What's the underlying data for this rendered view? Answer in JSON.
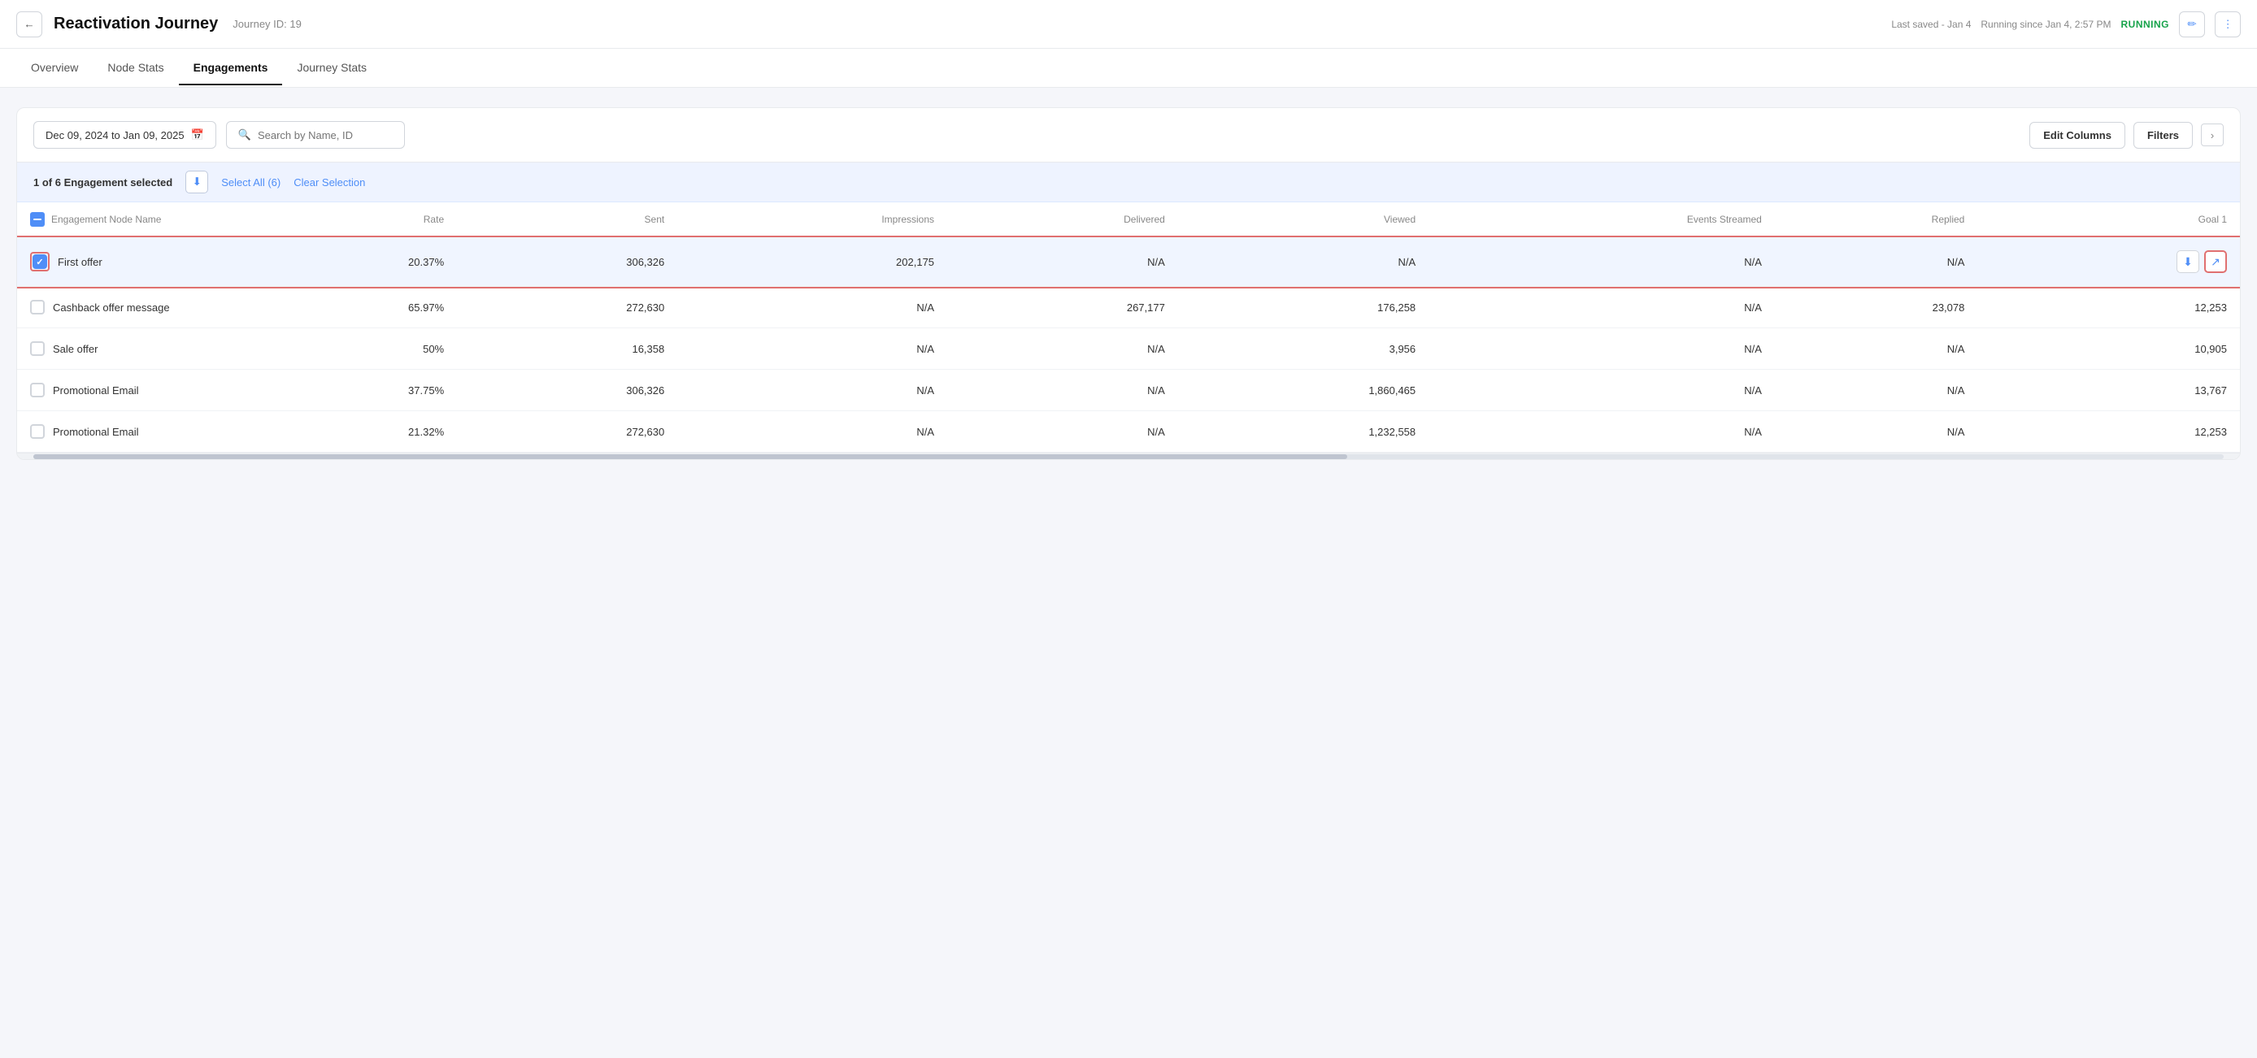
{
  "header": {
    "back_label": "←",
    "title": "Reactivation Journey",
    "journey_id_label": "Journey ID: 19",
    "meta_saved": "Last saved - Jan 4",
    "meta_running": "Running since Jan 4, 2:57 PM",
    "running_status": "RUNNING",
    "edit_icon": "✏",
    "more_icon": "⋮"
  },
  "tabs": {
    "items": [
      {
        "label": "Overview",
        "active": false
      },
      {
        "label": "Node Stats",
        "active": false
      },
      {
        "label": "Engagements",
        "active": true
      },
      {
        "label": "Journey Stats",
        "active": false
      }
    ]
  },
  "toolbar": {
    "date_range": "Dec 09, 2024 to Jan 09, 2025",
    "search_placeholder": "Search by Name, ID",
    "edit_columns_label": "Edit Columns",
    "filters_label": "Filters"
  },
  "selection_bar": {
    "text": "1 of 6 Engagement selected",
    "select_all_label": "Select All (6)",
    "clear_selection_label": "Clear Selection"
  },
  "table": {
    "columns": [
      "Engagement Node Name",
      "Rate",
      "Sent",
      "Impressions",
      "Delivered",
      "Viewed",
      "Events Streamed",
      "Replied",
      "Goal 1"
    ],
    "rows": [
      {
        "selected": true,
        "name": "First offer",
        "rate": "20.37%",
        "sent": "306,326",
        "impressions": "202,175",
        "delivered": "N/A",
        "viewed": "N/A",
        "events_streamed": "N/A",
        "replied": "N/A",
        "goal1": ""
      },
      {
        "selected": false,
        "name": "Cashback offer message",
        "rate": "65.97%",
        "sent": "272,630",
        "impressions": "N/A",
        "delivered": "267,177",
        "viewed": "176,258",
        "events_streamed": "N/A",
        "replied": "23,078",
        "goal1": "12,253"
      },
      {
        "selected": false,
        "name": "Sale offer",
        "rate": "50%",
        "sent": "16,358",
        "impressions": "N/A",
        "delivered": "N/A",
        "viewed": "3,956",
        "events_streamed": "N/A",
        "replied": "N/A",
        "goal1": "10,905"
      },
      {
        "selected": false,
        "name": "Promotional Email",
        "rate": "37.75%",
        "sent": "306,326",
        "impressions": "N/A",
        "delivered": "N/A",
        "viewed": "1,860,465",
        "events_streamed": "N/A",
        "replied": "N/A",
        "goal1": "13,767"
      },
      {
        "selected": false,
        "name": "Promotional Email",
        "rate": "21.32%",
        "sent": "272,630",
        "impressions": "N/A",
        "delivered": "N/A",
        "viewed": "1,232,558",
        "events_streamed": "N/A",
        "replied": "N/A",
        "goal1": "12,253"
      }
    ]
  }
}
